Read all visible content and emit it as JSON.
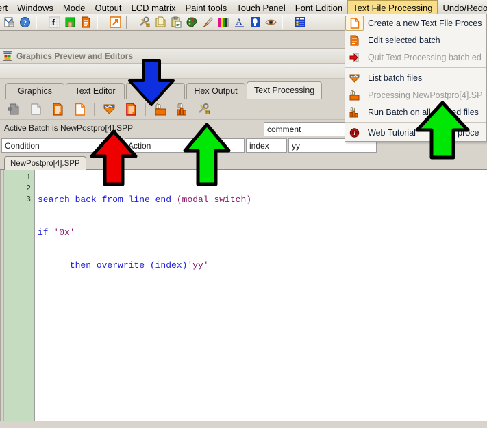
{
  "menubar": {
    "items": [
      {
        "label": "ert",
        "active": false
      },
      {
        "label": "Windows",
        "active": false
      },
      {
        "label": "Mode",
        "active": false
      },
      {
        "label": "Output",
        "active": false
      },
      {
        "label": "LCD matrix",
        "active": false
      },
      {
        "label": "Paint tools",
        "active": false
      },
      {
        "label": "Touch Panel",
        "active": false
      },
      {
        "label": "Font Edition",
        "active": false
      },
      {
        "label": "Text File Processing",
        "active": true
      },
      {
        "label": "Undo/Redo",
        "active": false
      }
    ],
    "active_color": "#f8dd8a"
  },
  "toolbar": {
    "icons": [
      "envelope-document-icon",
      "help-question-icon",
      "font-f-icon",
      "green-door-icon",
      "orange-lines-document-icon",
      "orange-arrow-export-icon",
      "tools-hammer-wrench-icon",
      "copy-folder-icon",
      "paste-clipboard-icon",
      "palette-icon",
      "paintbrush-icon",
      "color-bars-icon",
      "font-a-icon",
      "lightbulb-icon",
      "eye-icon",
      "blue-grid-table-icon"
    ]
  },
  "window": {
    "title": "Graphics Preview and Editors",
    "title_icon": "application-window-icon"
  },
  "tabs": [
    {
      "label": "Graphics",
      "selected": false
    },
    {
      "label": "Text Editor",
      "selected": false
    },
    {
      "label": "",
      "selected": false
    },
    {
      "label": "Hex Output",
      "selected": false
    },
    {
      "label": "Text Processing",
      "selected": true
    }
  ],
  "toolbar2": {
    "icons": [
      "grey-page-back-icon",
      "grey-page-blank-icon",
      "orange-lines-document-icon",
      "orange-outline-document-icon",
      "blue-down-arrow-icon",
      "red-outline-document-icon",
      "orange-box-hand-icon",
      "bar-chart-hand-icon",
      "hammer-wrench-icon"
    ]
  },
  "status": {
    "text": "Active Batch is NewPostpro[4].SPP"
  },
  "fields": {
    "condition": {
      "value": "Condition",
      "placeholder": "Condition"
    },
    "action": {
      "value": "Action",
      "placeholder": "Action"
    },
    "index": {
      "value": "index",
      "placeholder": "index"
    },
    "yy": {
      "value": "yy",
      "placeholder": "yy"
    },
    "comment": {
      "value": "comment",
      "placeholder": "comment"
    }
  },
  "file_tab": {
    "label": "NewPostpro[4].SPP"
  },
  "editor": {
    "line_numbers": [
      "1",
      "2",
      "3"
    ],
    "lines": [
      [
        {
          "t": "search back from line end ",
          "c": "kw"
        },
        {
          "t": "(modal switch)",
          "c": "str"
        }
      ],
      [
        {
          "t": "if ",
          "c": "kw"
        },
        {
          "t": "'0x'",
          "c": "str"
        }
      ],
      [
        {
          "t": "      then overwrite ",
          "c": "kw"
        },
        {
          "t": "(index)",
          "c": "kw"
        },
        {
          "t": "'yy'",
          "c": "str"
        }
      ]
    ],
    "gutter_color": "#c6dcc0",
    "keyword_color": "#1f1fd8",
    "string_color": "#8b1a6b"
  },
  "dropdown": {
    "items": [
      {
        "label": "Create a new Text File Proces",
        "icon": "new-document-icon",
        "disabled": false,
        "selected": true
      },
      {
        "label": "Edit selected batch",
        "icon": "orange-lines-document-icon",
        "disabled": false,
        "selected": false
      },
      {
        "label": "Quit Text Processing batch ed",
        "icon": "red-exit-arrow-icon",
        "disabled": true,
        "selected": false
      },
      {
        "separator": true
      },
      {
        "label": "List batch files",
        "icon": "orange-down-arrow-icon",
        "disabled": false,
        "selected": false
      },
      {
        "label": "Processing NewPostpro[4].SP",
        "icon": "orange-box-hand-icon",
        "disabled": true,
        "selected": false
      },
      {
        "label": "Run Batch on all defined files",
        "icon": "bar-chart-hand-icon",
        "disabled": false,
        "selected": false
      },
      {
        "separator": true
      },
      {
        "label": "Web Tutorial",
        "label2": "xt proce",
        "icon": "red-info-icon",
        "disabled": false,
        "selected": false
      }
    ]
  },
  "annotations": {
    "arrows": [
      {
        "name": "blue-down-arrow-annotation",
        "color": "#0d2fe0",
        "direction": "down"
      },
      {
        "name": "red-up-arrow-annotation",
        "color": "#ee0000",
        "direction": "up"
      },
      {
        "name": "green-up-arrow-annotation-left",
        "color": "#00e605",
        "direction": "up"
      },
      {
        "name": "green-up-arrow-annotation-right",
        "color": "#00e605",
        "direction": "up"
      }
    ]
  }
}
